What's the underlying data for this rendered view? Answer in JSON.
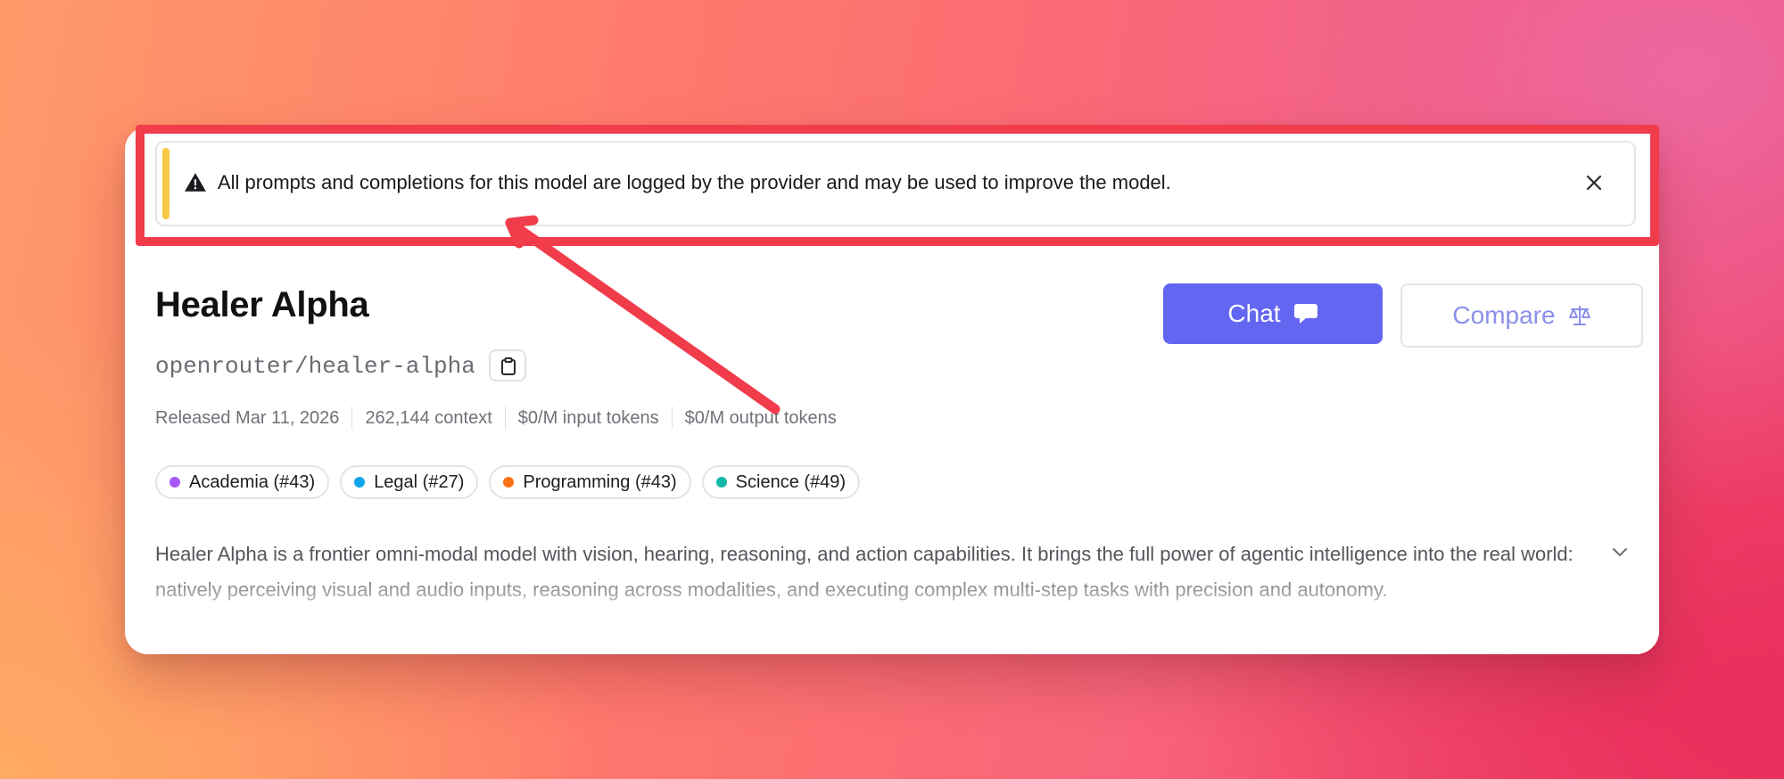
{
  "banner": {
    "message": "All prompts and completions for this model are logged by the provider and may be used to improve the model.",
    "icon": "warning-triangle-icon",
    "accent_color": "#f5c842"
  },
  "model": {
    "title": "Healer Alpha",
    "slug": "openrouter/healer-alpha",
    "meta": [
      "Released Mar 11, 2026",
      "262,144 context",
      "$0/M input tokens",
      "$0/M output tokens"
    ],
    "tags": [
      {
        "label": "Academia (#43)",
        "color": "#a855f7"
      },
      {
        "label": "Legal (#27)",
        "color": "#0ea5e9"
      },
      {
        "label": "Programming (#43)",
        "color": "#f97316"
      },
      {
        "label": "Science (#49)",
        "color": "#14b8a6"
      }
    ],
    "description": "Healer Alpha is a frontier omni-modal model with vision, hearing, reasoning, and action capabilities. It brings the full power of agentic intelligence into the real world: natively perceiving visual and audio inputs, reasoning across modalities, and executing complex multi-step tasks with precision and autonomy."
  },
  "actions": {
    "chat_label": "Chat",
    "chat_color": "#6366f1",
    "compare_label": "Compare"
  },
  "annotation": {
    "highlight_color": "#f13c4b"
  }
}
